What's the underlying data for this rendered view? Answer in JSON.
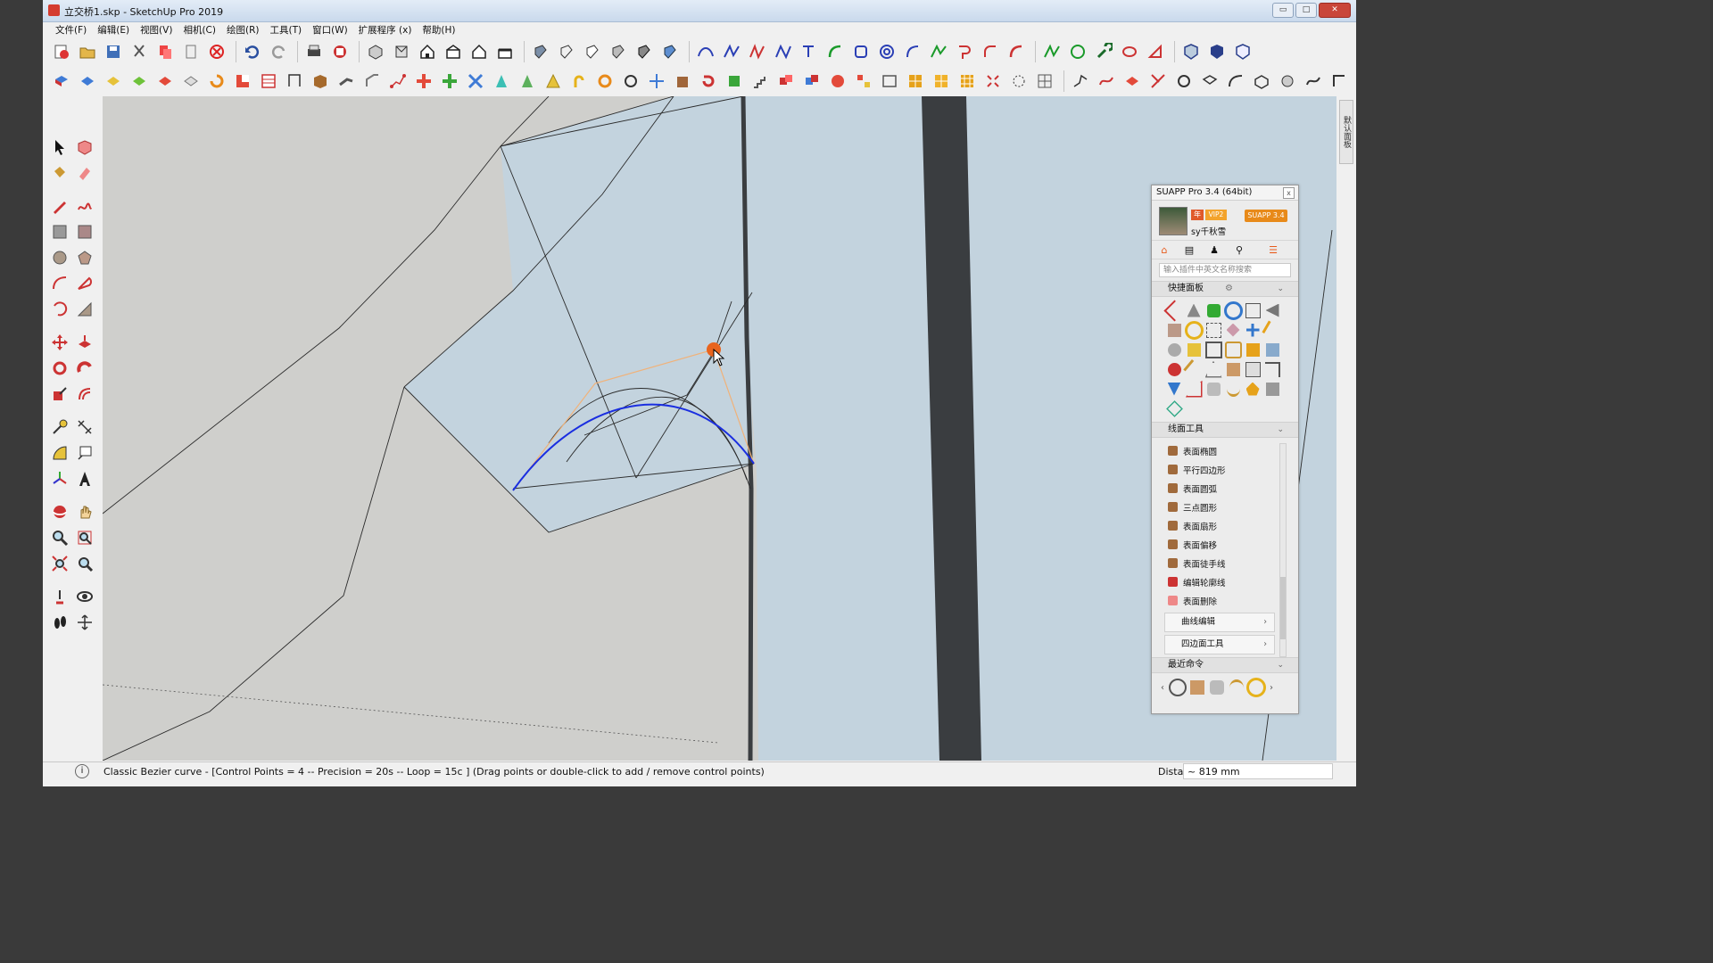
{
  "window": {
    "title": "立交桥1.skp - SketchUp Pro 2019",
    "min_label": "▭",
    "max_label": "□",
    "close_label": "✕"
  },
  "menu": [
    "文件(F)",
    "编辑(E)",
    "视图(V)",
    "相机(C)",
    "绘图(R)",
    "工具(T)",
    "窗口(W)",
    "扩展程序 (x)",
    "帮助(H)"
  ],
  "suapp": {
    "title": "SUAPP Pro 3.4 (64bit)",
    "close": "x",
    "badge_year": "年",
    "badge_vip": "VIP2",
    "badge_version": "SUAPP 3.4",
    "username": "sy千秋雪",
    "search_placeholder": "输入插件中英文名称搜索",
    "quick_panel": "快捷面板",
    "line_tools": "线面工具",
    "line_tool_items": [
      "表面椭圆",
      "平行四边形",
      "表面圆弧",
      "三点圆形",
      "表面扇形",
      "表面偏移",
      "表面徒手线",
      "编辑轮廓线",
      "表面删除"
    ],
    "curve_edit": "曲线编辑",
    "quad_tools": "四边面工具",
    "recent": "最近命令"
  },
  "status": {
    "text": "Classic Bezier curve - [Control Points = 4  -- Precision = 20s  -- Loop = 15c ]   (Drag points or double-click to add / remove control points)",
    "distance_label": "Distance",
    "distance_value": "~ 819 mm"
  },
  "right_tab": "默认面板",
  "colors": {
    "viewport_ground": "#cfcfcc",
    "water": "#c3d3de",
    "bezier": "#1a2ee0",
    "control_point": "#e8641e",
    "control_poly": "#f0b27a"
  }
}
